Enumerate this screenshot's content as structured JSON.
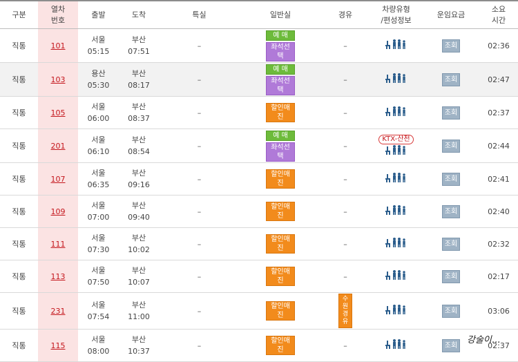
{
  "headers": {
    "type": "구분",
    "train_no": "열차\n번호",
    "depart": "출발",
    "arrive": "도착",
    "special": "특실",
    "general": "일반실",
    "via": "경유",
    "vehicle": "차량유형\n/편성정보",
    "fare": "운임요금",
    "duration": "소요\n시간"
  },
  "labels": {
    "reserve": "예 매",
    "seat_select": "좌석선택",
    "discount_soldout": "할인매진",
    "fare_check": "조회",
    "dash": "–",
    "ktx_sancheon": "KTX-산천",
    "via_suwon": "수원\n경유"
  },
  "rows": [
    {
      "type": "직통",
      "train_no": "101",
      "dep_station": "서울",
      "dep_time": "05:15",
      "arr_station": "부산",
      "arr_time": "07:51",
      "general": "reserve",
      "via": "–",
      "vehicle": "ktx",
      "duration": "02:36"
    },
    {
      "type": "직통",
      "train_no": "103",
      "dep_station": "용산",
      "dep_time": "05:30",
      "arr_station": "부산",
      "arr_time": "08:17",
      "general": "reserve",
      "via": "–",
      "vehicle": "ktx",
      "duration": "02:47"
    },
    {
      "type": "직통",
      "train_no": "105",
      "dep_station": "서울",
      "dep_time": "06:00",
      "arr_station": "부산",
      "arr_time": "08:37",
      "general": "soldout",
      "via": "–",
      "vehicle": "ktx",
      "duration": "02:37"
    },
    {
      "type": "직통",
      "train_no": "201",
      "dep_station": "서울",
      "dep_time": "06:10",
      "arr_station": "부산",
      "arr_time": "08:54",
      "general": "reserve",
      "via": "–",
      "vehicle": "sancheon",
      "duration": "02:44"
    },
    {
      "type": "직통",
      "train_no": "107",
      "dep_station": "서울",
      "dep_time": "06:35",
      "arr_station": "부산",
      "arr_time": "09:16",
      "general": "soldout",
      "via": "–",
      "vehicle": "ktx",
      "duration": "02:41"
    },
    {
      "type": "직통",
      "train_no": "109",
      "dep_station": "서울",
      "dep_time": "07:00",
      "arr_station": "부산",
      "arr_time": "09:40",
      "general": "soldout",
      "via": "–",
      "vehicle": "ktx",
      "duration": "02:40"
    },
    {
      "type": "직통",
      "train_no": "111",
      "dep_station": "서울",
      "dep_time": "07:30",
      "arr_station": "부산",
      "arr_time": "10:02",
      "general": "soldout",
      "via": "–",
      "vehicle": "ktx",
      "duration": "02:32"
    },
    {
      "type": "직통",
      "train_no": "113",
      "dep_station": "서울",
      "dep_time": "07:50",
      "arr_station": "부산",
      "arr_time": "10:07",
      "general": "soldout",
      "via": "–",
      "vehicle": "ktx",
      "duration": "02:17"
    },
    {
      "type": "직통",
      "train_no": "231",
      "dep_station": "서울",
      "dep_time": "07:54",
      "arr_station": "부산",
      "arr_time": "11:00",
      "general": "soldout",
      "via": "suwon",
      "vehicle": "ktx",
      "duration": "03:06"
    },
    {
      "type": "직통",
      "train_no": "115",
      "dep_station": "서울",
      "dep_time": "08:00",
      "arr_station": "부산",
      "arr_time": "10:37",
      "general": "soldout",
      "via": "–",
      "vehicle": "ktx",
      "duration": "02:37"
    }
  ],
  "watermark": "강술이...",
  "colors": {
    "reserve_green": "#6dbb3b",
    "seat_purple": "#b07ad8",
    "soldout_orange": "#f28b1c",
    "train_link_red": "#c4161c",
    "train_col_pink": "#fbe3e3",
    "fare_button": "#9fb3c5",
    "vehicle_icon": "#2b5d8c"
  }
}
